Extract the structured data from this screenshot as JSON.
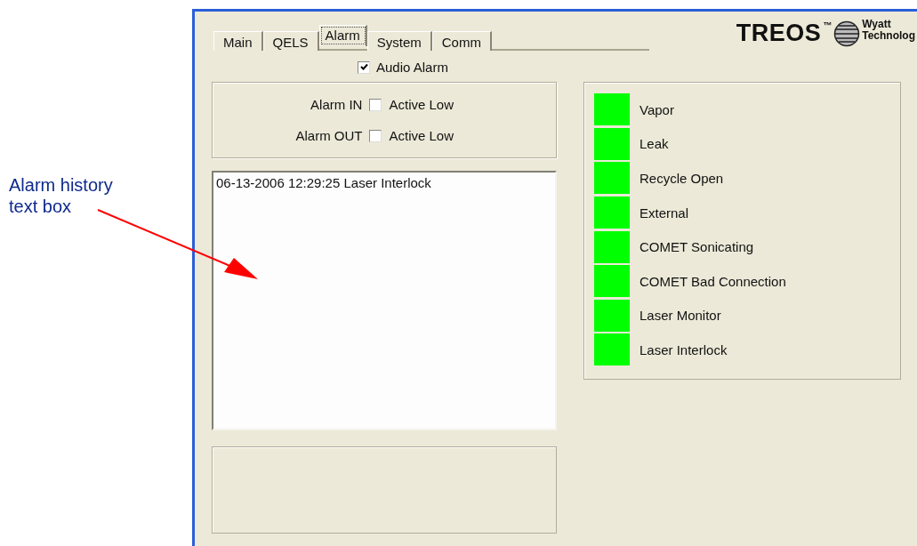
{
  "annotation": {
    "text": "Alarm history text box"
  },
  "tabs": [
    {
      "label": "Main",
      "selected": false
    },
    {
      "label": "QELS",
      "selected": false
    },
    {
      "label": "Alarm",
      "selected": true
    },
    {
      "label": "System",
      "selected": false
    },
    {
      "label": "Comm",
      "selected": false
    }
  ],
  "logo": {
    "name": "TREOS",
    "trademark": "™",
    "company_line_1": "Wyatt",
    "company_line_2": "Technolog"
  },
  "audio_alarm": {
    "label": "Audio Alarm",
    "checked": true
  },
  "alarm_settings": [
    {
      "label": "Alarm IN",
      "option": "Active Low",
      "checked": false
    },
    {
      "label": "Alarm OUT",
      "option": "Active Low",
      "checked": false
    }
  ],
  "alarm_history": [
    "06-13-2006 12:29:25 Laser Interlock"
  ],
  "indicators": [
    {
      "label": "Vapor",
      "color": "#00ff00"
    },
    {
      "label": "Leak",
      "color": "#00ff00"
    },
    {
      "label": "Recycle Open",
      "color": "#00ff00"
    },
    {
      "label": "External",
      "color": "#00ff00"
    },
    {
      "label": "COMET Sonicating",
      "color": "#00ff00"
    },
    {
      "label": "COMET Bad Connection",
      "color": "#00ff00"
    },
    {
      "label": "Laser Monitor",
      "color": "#00ff00"
    },
    {
      "label": "Laser Interlock",
      "color": "#00ff00"
    }
  ]
}
